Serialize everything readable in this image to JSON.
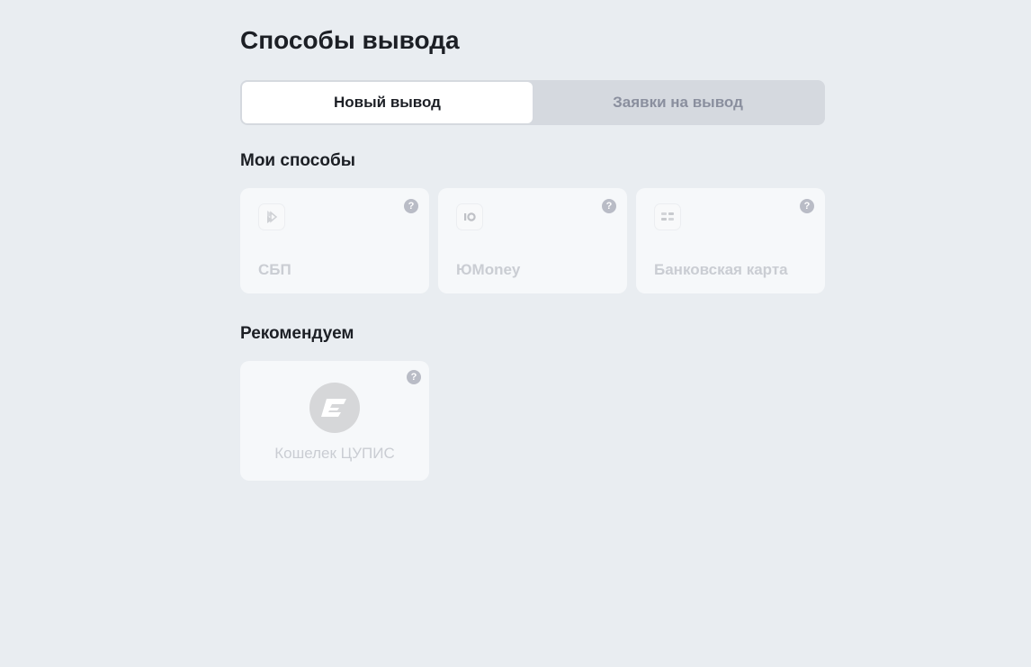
{
  "page": {
    "title": "Способы вывода"
  },
  "tabs": [
    {
      "label": "Новый вывод",
      "active": true
    },
    {
      "label": "Заявки на вывод",
      "active": false
    }
  ],
  "my_methods": {
    "title": "Мои способы",
    "items": [
      {
        "label": "СБП",
        "icon": "sbp-icon"
      },
      {
        "label": "ЮMoney",
        "icon": "yoomoney-icon"
      },
      {
        "label": "Банковская карта",
        "icon": "bank-card-icon"
      }
    ]
  },
  "recommended": {
    "title": "Рекомендуем",
    "items": [
      {
        "label": "Кошелек ЦУПИС",
        "icon": "cupis-wallet-icon"
      }
    ]
  },
  "help_glyph": "?",
  "colors": {
    "background": "#e9edf1",
    "card": "#f6f8fa",
    "tab_track": "#d5d9df",
    "tab_active": "#ffffff",
    "muted_text": "#cacdd3",
    "help_icon": "#b9bcc6"
  }
}
